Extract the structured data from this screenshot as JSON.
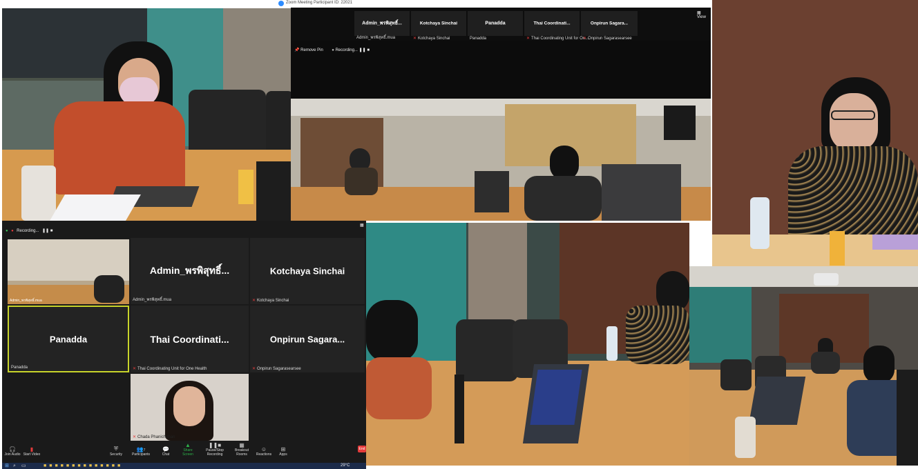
{
  "zoom_top": {
    "title": "Zoom Meeting Participant ID: 22021",
    "view_label": "View",
    "participants": [
      {
        "name": "Admin_พรพิสุทธิ์...",
        "sub": "Admin_พรพิสุทธิ์.mua"
      },
      {
        "name": "Kotchaya Sinchai",
        "sub": "Kotchaya Sinchai"
      },
      {
        "name": "Panadda",
        "sub": "Panadda"
      },
      {
        "name": "Thai Coordinati...",
        "sub": "Thai Coordinating Unit for On..."
      },
      {
        "name": "Onpirun Sagara...",
        "sub": "Onpirun Sagarasearsee"
      }
    ],
    "remove_pin": "Remove Pin",
    "recording": "Recording..."
  },
  "zoom_bottom": {
    "recording": "Recording...",
    "self_label": "Admin_พรพิสุทธิ์.mua",
    "tiles": [
      {
        "name": "Admin_พรพิสุทธิ์...",
        "sub": "Admin_พรพิสุทธิ์.mua"
      },
      {
        "name": "Kotchaya Sinchai",
        "sub": "Kotchaya Sinchai"
      },
      {
        "name": "Panadda",
        "sub": "Panadda"
      },
      {
        "name": "Thai Coordinati...",
        "sub": "Thai Coordinating Unit for One Health"
      },
      {
        "name": "Onpirun Sagara...",
        "sub": "Onpirun Sagarasearsee"
      },
      {
        "name": "",
        "sub": "Chada Phanichphan"
      }
    ],
    "toolbar": [
      "Join Audio",
      "Start Video",
      "Security",
      "Participants",
      "Chat",
      "Share Screen",
      "Pause/Stop Recording",
      "Breakout Rooms",
      "Reactions",
      "Apps"
    ],
    "participants_count": "7",
    "end_label": "End"
  },
  "taskbar": {
    "temperature": "29°C"
  },
  "colors": {
    "zoom_bg": "#1a1a1a",
    "tile_bg": "#232323",
    "active_border": "#c8d42a",
    "taskbar": "#1c2b4a",
    "recording_red": "#e43b3b",
    "share_green": "#2db34a"
  }
}
